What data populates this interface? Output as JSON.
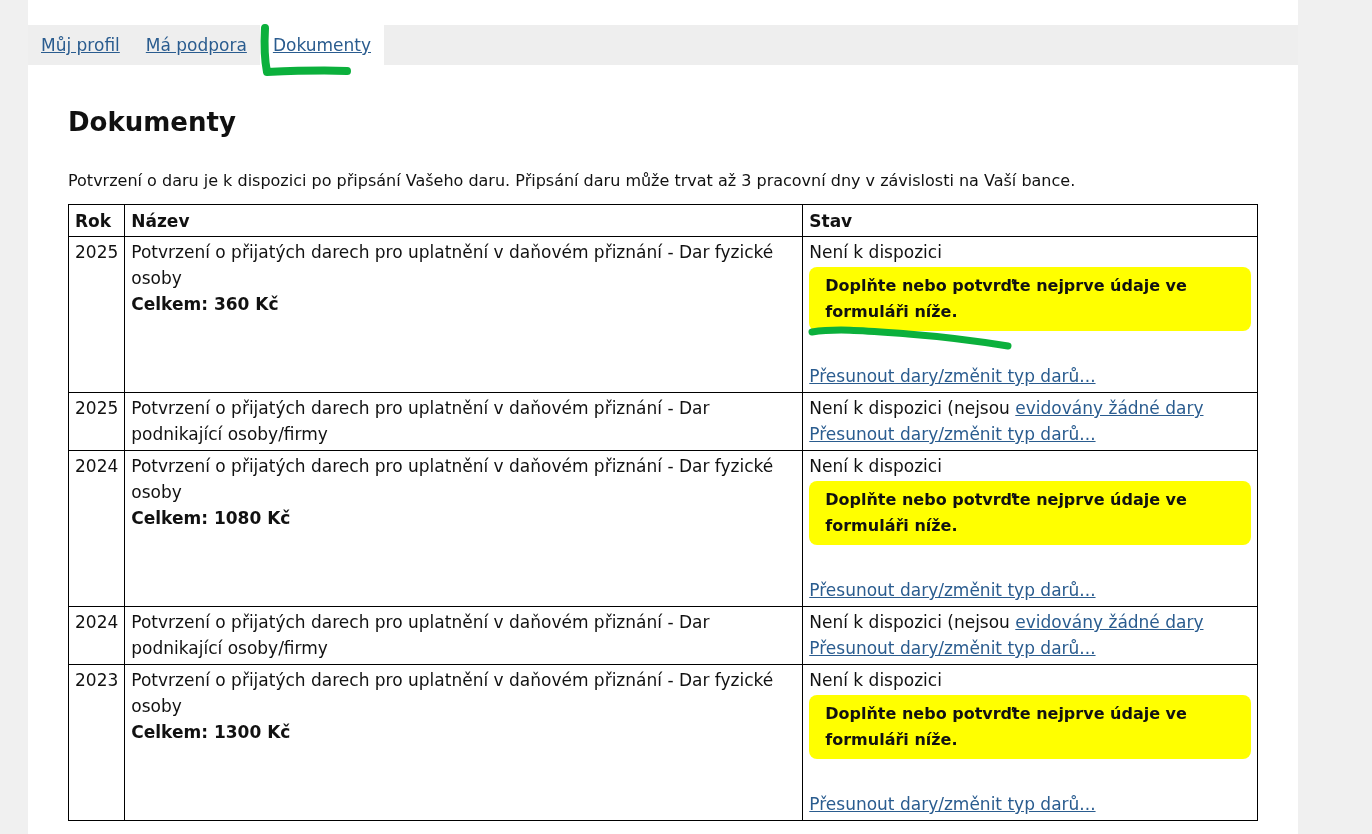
{
  "tabs": [
    {
      "label": "Můj profil",
      "selected": false
    },
    {
      "label": "Má podpora",
      "selected": false
    },
    {
      "label": "Dokumenty",
      "selected": true
    }
  ],
  "heading": "Dokumenty",
  "intro": "Potvrzení o daru je k dispozici po připsání Vašeho daru. Připsání daru může trvat až 3 pracovní dny v závislosti na Vaší bance.",
  "table": {
    "columns": [
      "Rok",
      "Název",
      "Stav"
    ],
    "rows": [
      {
        "kind": "individual",
        "year": "2025",
        "name": "Potvrzení o přijatých darech pro uplatnění v daňovém přiznání - Dar fyzické osoby",
        "total": "Celkem: 360 Kč",
        "status": "Není k dispozici",
        "notice": "Doplňte nebo potvrďte nejprve údaje ve formuláři níže.",
        "link": "Přesunout dary/změnit typ darů..."
      },
      {
        "kind": "company",
        "year": "2025",
        "name": "Potvrzení o přijatých darech pro uplatnění v daňovém přiznání - Dar podnikající osoby/firmy",
        "status": "Není k dispozici (nejsou",
        "status_link": "evidovány žádné dary",
        "link": "Přesunout dary/změnit typ darů..."
      },
      {
        "kind": "individual",
        "year": "2024",
        "name": "Potvrzení o přijatých darech pro uplatnění v daňovém přiznání - Dar fyzické osoby",
        "total": "Celkem: 1080 Kč",
        "status": "Není k dispozici",
        "notice": "Doplňte nebo potvrďte nejprve údaje ve formuláři níže.",
        "link": "Přesunout dary/změnit typ darů..."
      },
      {
        "kind": "company",
        "year": "2024",
        "name": "Potvrzení o přijatých darech pro uplatnění v daňovém přiznání - Dar podnikající osoby/firmy",
        "status": "Není k dispozici (nejsou",
        "status_link": "evidovány žádné dary",
        "link": "Přesunout dary/změnit typ darů..."
      },
      {
        "kind": "individual",
        "year": "2023",
        "name": "Potvrzení o přijatých darech pro uplatnění v daňovém přiznání - Dar fyzické osoby",
        "total": "Celkem: 1300 Kč",
        "status": "Není k dispozici",
        "notice": "Doplňte nebo potvrďte nejprve údaje ve formuláři níže.",
        "link": "Přesunout dary/změnit typ darů..."
      }
    ]
  }
}
